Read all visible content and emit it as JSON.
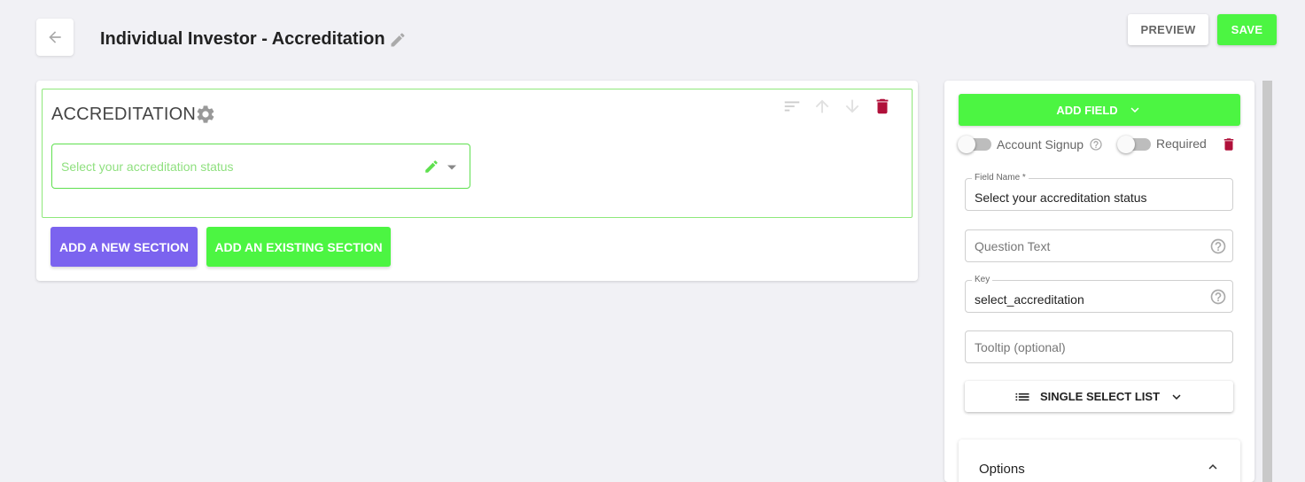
{
  "header": {
    "title": "Individual Investor - Accreditation",
    "preview_label": "PREVIEW",
    "save_label": "SAVE"
  },
  "colors": {
    "accent_green": "#4cf542",
    "accent_purple": "#7b63ef",
    "danger": "#b0103a"
  },
  "section": {
    "title": "ACCREDITATION",
    "select_placeholder": "Select your accreditation status"
  },
  "actions": {
    "add_new_section": "ADD A NEW SECTION",
    "add_existing_section": "ADD AN EXISTING SECTION"
  },
  "panel": {
    "add_field_label": "ADD FIELD",
    "account_signup_label": "Account Signup",
    "account_signup_on": false,
    "required_label": "Required",
    "required_on": false,
    "field_name": {
      "label": "Field Name *",
      "value": "Select your accreditation status"
    },
    "question_text": {
      "placeholder": "Question Text"
    },
    "key": {
      "label": "Key",
      "value": "select_accreditation"
    },
    "tooltip": {
      "placeholder": "Tooltip (optional)"
    },
    "field_type_label": "SINGLE SELECT LIST",
    "options_title": "Options"
  }
}
